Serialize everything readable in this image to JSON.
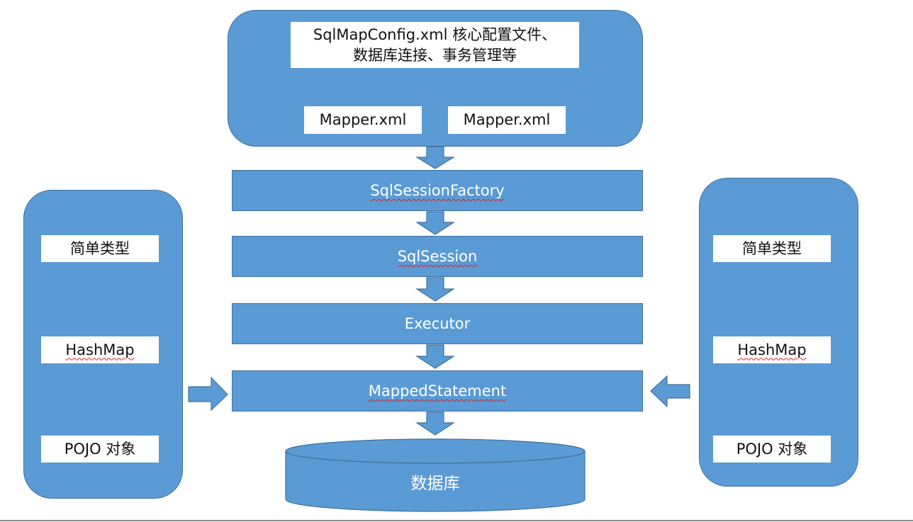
{
  "config": {
    "line1": "SqlMapConfig.xml 核心配置文件、",
    "line2": "数据库连接、事务管理等",
    "mappers": [
      "Mapper.xml",
      "Mapper.xml"
    ]
  },
  "flow": [
    "SqlSessionFactory",
    "SqlSession",
    "Executor",
    "MappedStatement"
  ],
  "database": "数据库",
  "input": {
    "items": [
      "简单类型",
      "HashMap",
      "POJO 对象"
    ]
  },
  "output": {
    "items": [
      "简单类型",
      "HashMap",
      "POJO 对象"
    ]
  },
  "colors": {
    "fill": "#5b9bd5",
    "border": "#41719c"
  }
}
